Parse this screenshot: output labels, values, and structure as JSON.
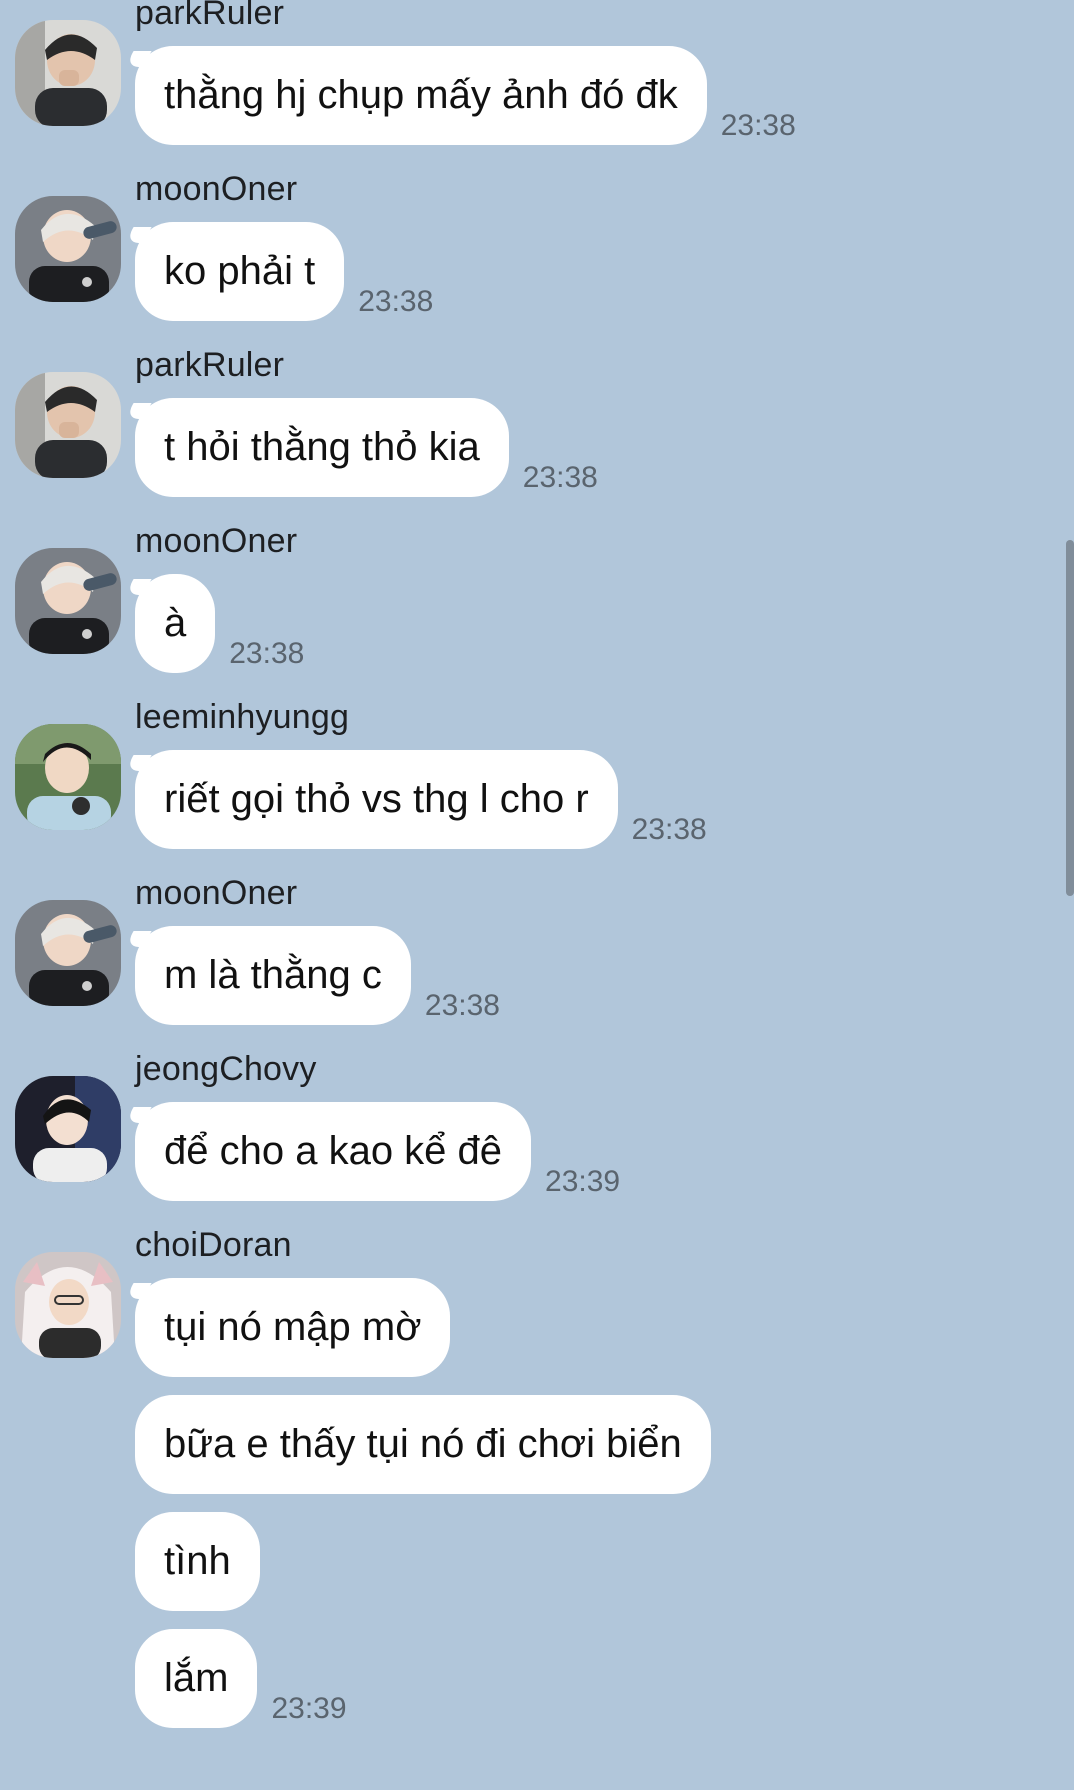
{
  "messages": [
    {
      "sender": "parkRuler",
      "avatar": "avatar-parkruler",
      "lines": [
        "thằng hj chụp mấy ảnh đó đk"
      ],
      "time": "23:38"
    },
    {
      "sender": "moonOner",
      "avatar": "avatar-moononer",
      "lines": [
        "ko phải t"
      ],
      "time": "23:38"
    },
    {
      "sender": "parkRuler",
      "avatar": "avatar-parkruler",
      "lines": [
        "t hỏi thằng thỏ kia"
      ],
      "time": "23:38"
    },
    {
      "sender": "moonOner",
      "avatar": "avatar-moononer",
      "lines": [
        "à"
      ],
      "time": "23:38"
    },
    {
      "sender": "leeminhyungg",
      "avatar": "avatar-leeminhyungg",
      "lines": [
        "riết gọi thỏ vs thg l cho r"
      ],
      "time": "23:38"
    },
    {
      "sender": "moonOner",
      "avatar": "avatar-moononer",
      "lines": [
        "m là thằng c"
      ],
      "time": "23:38"
    },
    {
      "sender": "jeongChovy",
      "avatar": "avatar-jeongchovy",
      "lines": [
        "để cho a kao kể đê"
      ],
      "time": "23:39"
    },
    {
      "sender": "choiDoran",
      "avatar": "avatar-choidoran",
      "lines": [
        "tụi nó mập mờ",
        "bữa e thấy tụi nó đi chơi biển",
        "tình",
        "lắm"
      ],
      "time": "23:39"
    }
  ],
  "colors": {
    "background": "#b1c6da",
    "bubble": "#ffffff",
    "timestamp": "#5a646e",
    "scrollbar": "#808d9a"
  }
}
